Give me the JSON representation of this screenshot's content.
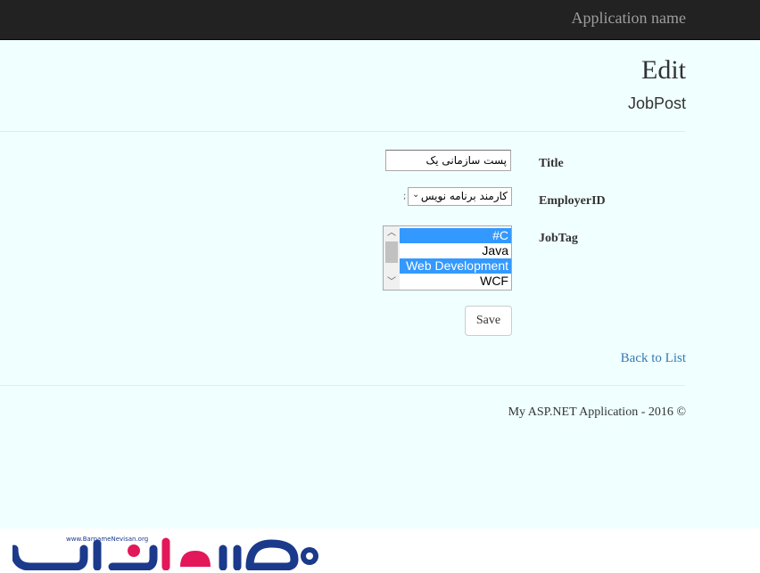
{
  "navbar": {
    "brand": "Application name"
  },
  "page": {
    "title": "Edit",
    "subtitle": "JobPost"
  },
  "form": {
    "title_label": "Title",
    "title_value": "پست سازمانی یک",
    "employer_label": "EmployerID",
    "employer_value": "کارمند برنامه نویس",
    "jobtag_label": "JobTag",
    "jobtag_options": [
      {
        "label": "#C",
        "selected": true
      },
      {
        "label": "Java",
        "selected": false
      },
      {
        "label": "Web Development",
        "selected": true
      },
      {
        "label": "WCF",
        "selected": false
      }
    ],
    "save_label": "Save"
  },
  "back_link": "Back to List",
  "footer": {
    "text": "My ASP.NET Application - 2016 ©"
  },
  "watermark": {
    "site": "www.BarnameNevisan.org",
    "logo_text": "برنامه نویسان"
  },
  "colors": {
    "navbar_bg": "#222222",
    "content_bg": "#f0ffff",
    "link": "#337ab7",
    "selected_option": "#3399ff",
    "logo_blue": "#1b3a8c",
    "logo_pink": "#e2185b"
  }
}
